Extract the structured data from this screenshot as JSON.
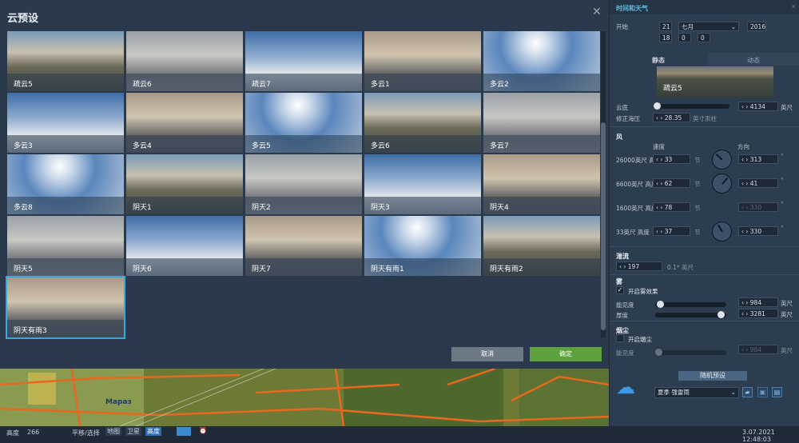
{
  "dialog": {
    "title": "云预设",
    "close": "✕",
    "cancel": "取消",
    "ok": "确定",
    "presets": [
      "疏云5",
      "疏云6",
      "疏云7",
      "多云1",
      "多云2",
      "多云3",
      "多云4",
      "多云5",
      "多云6",
      "多云7",
      "多云8",
      "阴天1",
      "阴天2",
      "阴天3",
      "阴天4",
      "阴天5",
      "阴天6",
      "阴天7",
      "阴天有雨1",
      "阴天有雨2",
      "阴天有雨3"
    ],
    "selected": "阴天有雨3"
  },
  "map": {
    "label": "Мараз"
  },
  "status": {
    "altitude_label": "高度",
    "altitude": "266",
    "mode": "平移/选择",
    "map": "地图",
    "satellite": "卫星",
    "height": "高度",
    "datetime": "3.07.2021 12:48:03"
  },
  "panel": {
    "title": "时间和天气",
    "close": "✕",
    "start_label": "开始",
    "day": "21",
    "month": "七月",
    "year": "2016",
    "hour": "18",
    "minute": "0",
    "second": "0",
    "tab_static": "静态",
    "tab_dynamic": "动态",
    "preview_label": "疏云5",
    "cloud_base_label": "云底",
    "cloud_base": "4134",
    "feet": "英尺",
    "qnh_label": "修正海压",
    "qnh": "28.35",
    "inhg": "英寸汞柱",
    "wind": {
      "title": "风",
      "speed": "速度",
      "direction": "方向",
      "knots": "节",
      "deg": "°",
      "rows": [
        {
          "label": "26000英尺 高",
          "speed": "33",
          "dir": "313",
          "angle": 313
        },
        {
          "label": "6600英尺 高度",
          "speed": "62",
          "dir": "41",
          "angle": 41
        },
        {
          "label": "1600英尺 高度",
          "speed": "78",
          "dir": "330",
          "angle": null
        },
        {
          "label": "33英尺 高度",
          "speed": "37",
          "dir": "330",
          "angle": 330
        }
      ]
    },
    "turb": {
      "title": "湍流",
      "value": "197",
      "unit": "0.1* 英尺"
    },
    "fog": {
      "title": "雾",
      "enable": "开启雾效果",
      "vis_label": "能见度",
      "vis": "984",
      "thick_label": "厚度",
      "thick": "3281",
      "vis_frac": 0.03,
      "thick_frac": 0.98
    },
    "dust": {
      "title": "烟尘",
      "enable": "开启烟尘",
      "vis_label": "能见度",
      "vis": "984"
    },
    "random": "随机预设",
    "preset": "夏季 强雷雨"
  }
}
